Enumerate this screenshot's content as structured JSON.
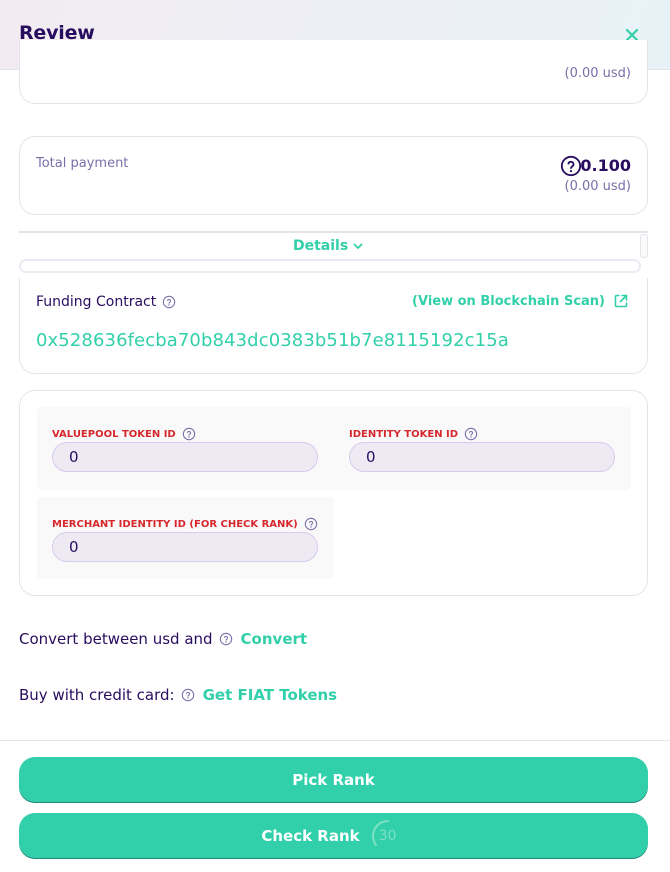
{
  "header": {
    "title": "Review"
  },
  "top_card": {
    "usd": "(0.00 usd)"
  },
  "total": {
    "label": "Total payment",
    "value": "0.100",
    "usd": "(0.00 usd)"
  },
  "details": {
    "label": "Details"
  },
  "contract": {
    "label": "Funding Contract",
    "view_link": "(View on Blockchain Scan)",
    "address": "0x528636fecba70b843dc0383b51b7e8115192c15a"
  },
  "form": {
    "valuepool_label": "VALUEPOOL TOKEN ID",
    "valuepool_value": "0",
    "identity_label": "IDENTITY TOKEN ID",
    "identity_value": "0",
    "merchant_label": "MERCHANT IDENTITY ID (FOR CHECK RANK)",
    "merchant_value": "0"
  },
  "convert": {
    "text": "Convert between usd and",
    "link": "Convert"
  },
  "buy": {
    "text": "Buy with credit card:",
    "link": "Get FIAT Tokens"
  },
  "buttons": {
    "pick_rank": "Pick Rank",
    "check_rank": "Check Rank",
    "countdown": "30"
  },
  "colors": {
    "accent": "#31d0aa",
    "text": "#280d5f",
    "muted": "#7a6eaa",
    "label_red": "#d6282c"
  }
}
